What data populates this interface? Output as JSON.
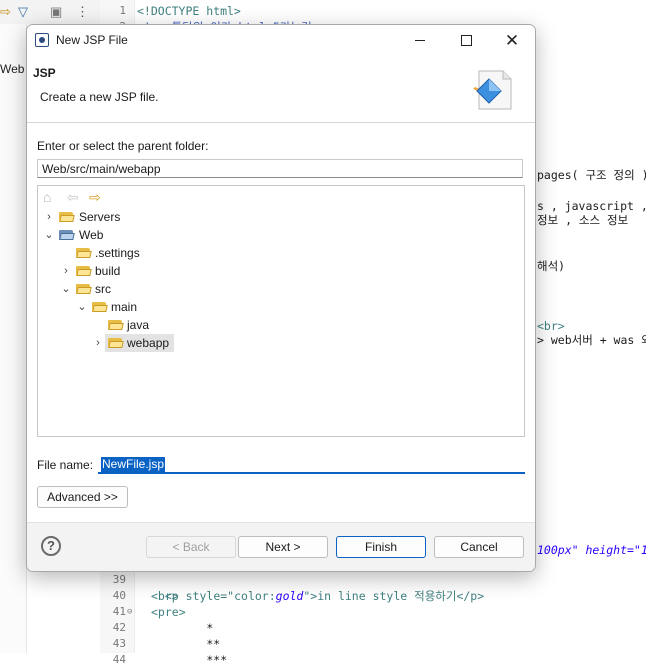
{
  "background": {
    "left_text": "Web",
    "toolbar_icons": [
      "import-icon",
      "filter-icon",
      "collapse-icon",
      "more-icon"
    ],
    "line_numbers_top": [
      "1",
      "2"
    ],
    "line_numbers_bottom": [
      "39",
      "40",
      "41",
      "42",
      "43",
      "44"
    ],
    "code_line1": "<!DOCTYPE html>",
    "code_line2": "<!-- 통단위 이라 html 5라는것 -->",
    "right_line1": "pages( 구조 정의 )",
    "right_line2": "s , javascript ,",
    "right_line3": "정보 , 소스 정보",
    "right_line4": "해석)",
    "right_line5": "<br>",
    "right_line6": "> web서버 + was 와",
    "right_line7": "100px\" height=\"1",
    "code_39_a": "<p style=\"color:",
    "code_39_b": "gold",
    "code_39_c": "\">in line style 적용하기</p>",
    "code_40": "<br>",
    "code_41": "<pre>",
    "code_42": "        *",
    "code_43": "        **",
    "code_44": "        ***"
  },
  "dialog": {
    "title": "New JSP File",
    "header_title": "JSP",
    "header_description": "Create a new JSP file.",
    "parent_label": "Enter or select the parent folder:",
    "parent_value": "Web/src/main/webapp",
    "tree": {
      "nav_icons": [
        "home-icon",
        "back-arrow-icon",
        "forward-arrow-icon"
      ],
      "items": [
        {
          "label": "Servers",
          "chevron": "›",
          "icon": "folder-icon"
        },
        {
          "label": "Web",
          "chevron": "⌄",
          "icon": "project-icon"
        },
        {
          "label": ".settings",
          "chevron": "",
          "icon": "folder-icon"
        },
        {
          "label": "build",
          "chevron": "›",
          "icon": "folder-icon"
        },
        {
          "label": "src",
          "chevron": "⌄",
          "icon": "folder-icon"
        },
        {
          "label": "main",
          "chevron": "⌄",
          "icon": "folder-icon"
        },
        {
          "label": "java",
          "chevron": "",
          "icon": "folder-icon"
        },
        {
          "label": "webapp",
          "chevron": "›",
          "icon": "folder-icon",
          "selected": true
        }
      ]
    },
    "file_name_label": "File name:",
    "file_name_value": "NewFile.jsp",
    "advanced_label": "Advanced >>",
    "help_label": "?",
    "back_label": "< Back",
    "next_label": "Next >",
    "finish_label": "Finish",
    "cancel_label": "Cancel",
    "accent_color": "#0a62c4"
  }
}
